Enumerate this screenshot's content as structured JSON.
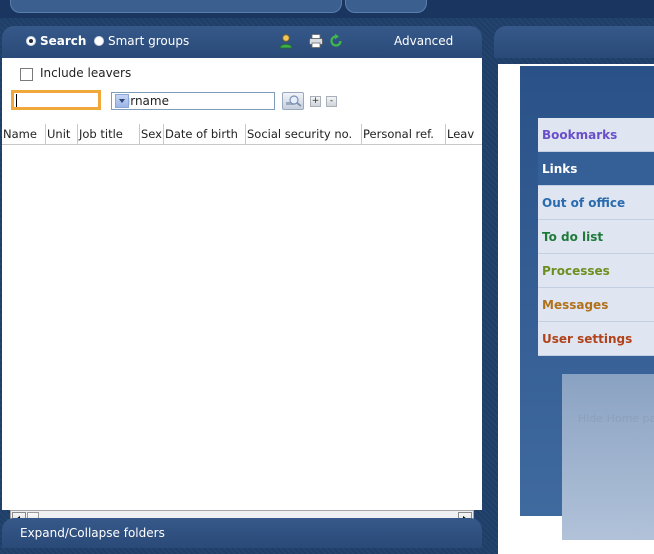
{
  "search_panel": {
    "mode_search_label": "Search",
    "mode_smart_label": "Smart groups",
    "advanced_label": "Advanced",
    "include_leavers_label": "Include leavers",
    "search_value": "",
    "field_select_value": "Surname",
    "plus_label": "+",
    "minus_label": "-",
    "columns": [
      "Name",
      "Unit",
      "Job title",
      "Sex",
      "Date of birth",
      "Social security no.",
      "Personal ref.",
      "Leav"
    ]
  },
  "footer": {
    "expand_collapse_label": "Expand/Collapse folders"
  },
  "home_menu": {
    "items": [
      {
        "label": "Bookmarks",
        "color": "#6a4fc9"
      },
      {
        "label": "Links",
        "color": "#ffffff"
      },
      {
        "label": "Out of office",
        "color": "#2a6bb0"
      },
      {
        "label": "To do list",
        "color": "#1f7a3a"
      },
      {
        "label": "Processes",
        "color": "#6d8f1f"
      },
      {
        "label": "Messages",
        "color": "#b1711b"
      },
      {
        "label": "User settings",
        "color": "#b1421b"
      }
    ],
    "hide_home_label": "Hide Home page"
  },
  "colors": {
    "accent_focus": "#f0a83a",
    "panel_header": "#2a4a78"
  }
}
